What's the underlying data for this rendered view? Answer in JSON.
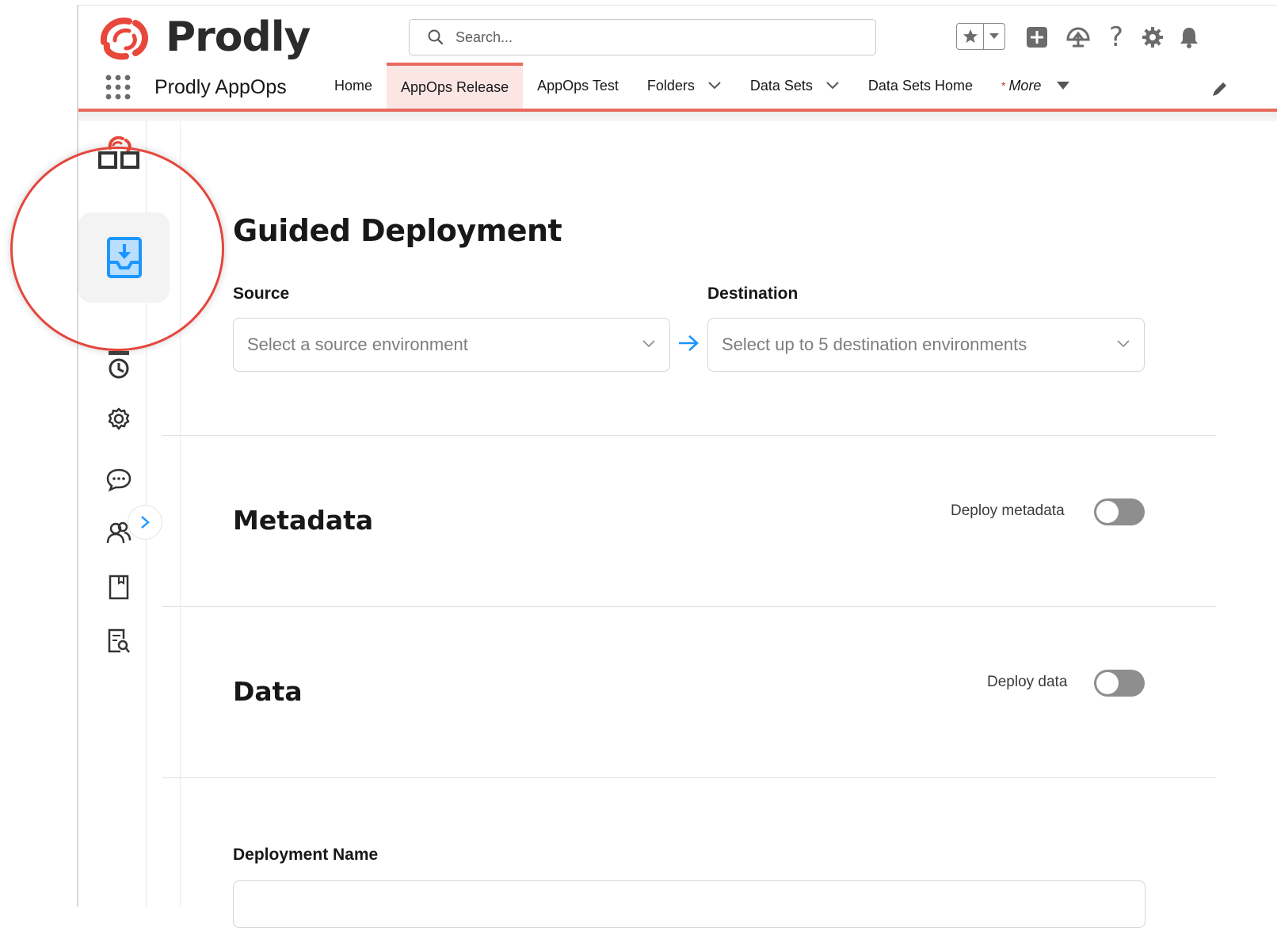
{
  "brand": {
    "logo_text": "Prodly",
    "colors": {
      "accent": "#e86a5e",
      "primary_blue": "#1b96ff",
      "text": "#181818"
    }
  },
  "header": {
    "search_placeholder": "Search...",
    "icons": [
      "favorites-star-icon",
      "add-icon",
      "trailhead-icon",
      "help-icon",
      "setup-gear-icon",
      "notifications-bell-icon",
      "user-avatar"
    ]
  },
  "nav": {
    "app_name": "Prodly AppOps",
    "tabs": [
      {
        "label": "Home",
        "dropdown": false
      },
      {
        "label": "AppOps Release",
        "dropdown": false,
        "active": true
      },
      {
        "label": "AppOps Test",
        "dropdown": false
      },
      {
        "label": "Folders",
        "dropdown": true
      },
      {
        "label": "Data Sets",
        "dropdown": true
      },
      {
        "label": "Data Sets Home",
        "dropdown": false
      }
    ],
    "more_marker": "*",
    "more_label": "More"
  },
  "rail": {
    "items": [
      "dashboard-icon",
      "deploy-icon",
      "history-icon",
      "settings-icon",
      "chat-icon",
      "users-icon",
      "bookmark-icon",
      "report-search-icon"
    ],
    "active": "deploy-icon"
  },
  "main": {
    "title": "Guided Deployment",
    "source": {
      "label": "Source",
      "placeholder": "Select a source environment"
    },
    "destination": {
      "label": "Destination",
      "placeholder": "Select up to 5 destination environments"
    },
    "metadata": {
      "title": "Metadata",
      "toggle_label": "Deploy metadata",
      "enabled": false
    },
    "data": {
      "title": "Data",
      "toggle_label": "Deploy data",
      "enabled": false
    },
    "deployment_name": {
      "label": "Deployment Name",
      "value": ""
    }
  }
}
